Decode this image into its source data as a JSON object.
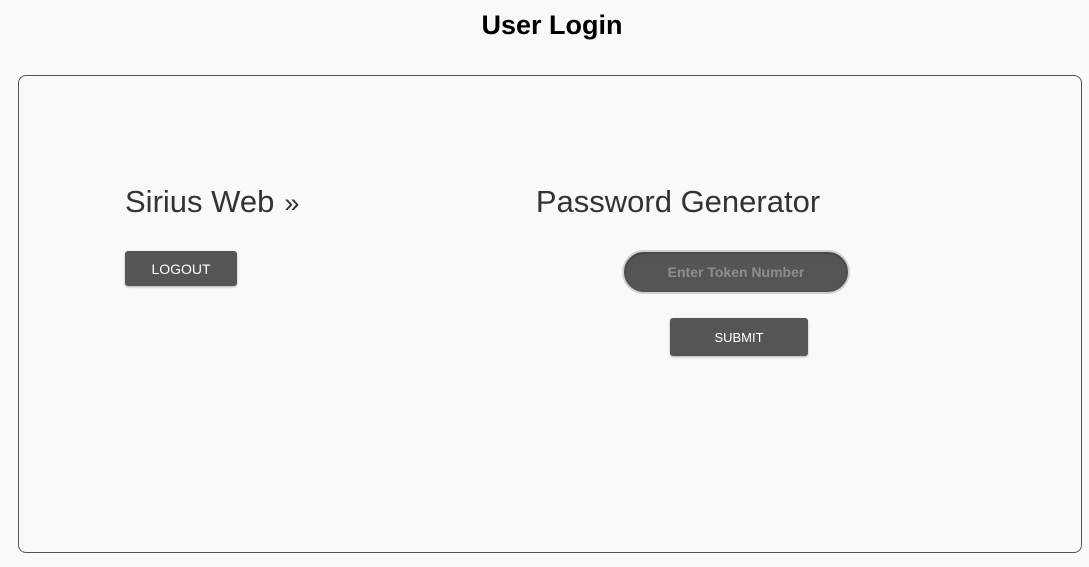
{
  "header": {
    "title": "User Login"
  },
  "left_panel": {
    "brand": "Sirius Web",
    "brand_suffix": "»",
    "logout_label": "LOGOUT"
  },
  "right_panel": {
    "title": "Password Generator",
    "token_input": {
      "value": "",
      "placeholder": "Enter Token Number"
    },
    "submit_label": "SUBMIT"
  },
  "colors": {
    "button_bg": "#555555",
    "button_text": "#ffffff",
    "page_bg": "#f9f9f9",
    "panel_border": "#555555"
  }
}
